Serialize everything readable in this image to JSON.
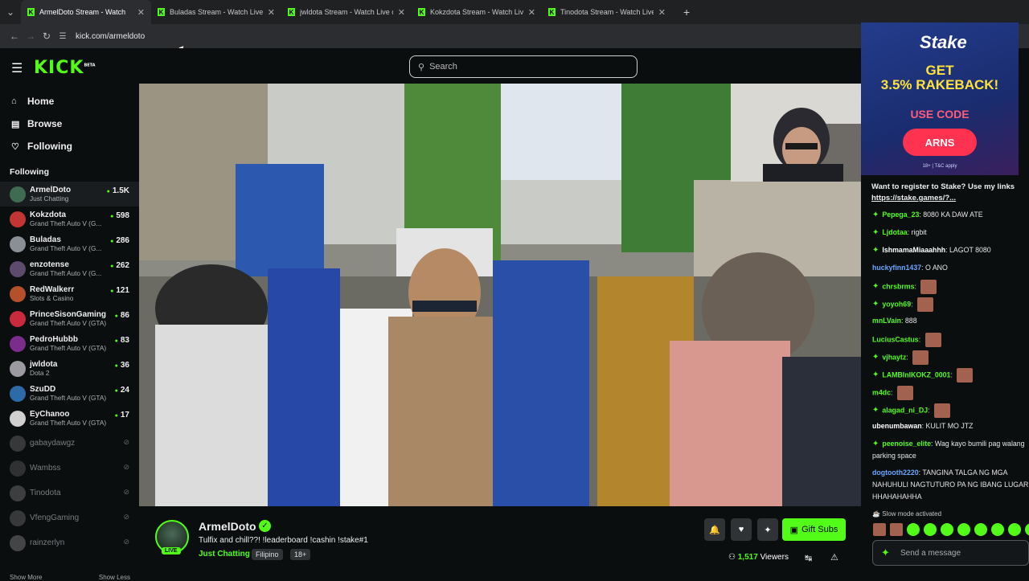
{
  "browser": {
    "tabs": [
      {
        "title": "ArmelDoto Stream - Watch",
        "active": true
      },
      {
        "title": "Buladas Stream - Watch Live on",
        "active": false
      },
      {
        "title": "jwldota Stream - Watch Live on",
        "active": false
      },
      {
        "title": "Kokzdota Stream - Watch Live o",
        "active": false
      },
      {
        "title": "Tinodota Stream - Watch Live o",
        "active": false
      }
    ],
    "url": "kick.com/armeldoto"
  },
  "header": {
    "logo": "KICK",
    "logo_beta": "BETA",
    "search_placeholder": "Search"
  },
  "sidebar": {
    "nav": [
      {
        "label": "Home",
        "icon": "home-icon"
      },
      {
        "label": "Browse",
        "icon": "browse-icon"
      },
      {
        "label": "Following",
        "icon": "heart-icon"
      }
    ],
    "following_title": "Following",
    "channels": [
      {
        "name": "ArmelDoto",
        "category": "Just Chatting",
        "viewers": "1.5K",
        "live": true,
        "color": "#3f6b52"
      },
      {
        "name": "Kokzdota",
        "category": "Grand Theft Auto V (G...",
        "viewers": "598",
        "live": true,
        "color": "#c23535"
      },
      {
        "name": "Buladas",
        "category": "Grand Theft Auto V (G...",
        "viewers": "286",
        "live": true,
        "color": "#8a8f96"
      },
      {
        "name": "enzotense",
        "category": "Grand Theft Auto V (G...",
        "viewers": "262",
        "live": true,
        "color": "#5d4b6e"
      },
      {
        "name": "RedWalkerr",
        "category": "Slots & Casino",
        "viewers": "121",
        "live": true,
        "color": "#b5502a"
      },
      {
        "name": "PrinceSisonGaming",
        "category": "Grand Theft Auto V (GTA)",
        "viewers": "86",
        "live": true,
        "color": "#c92a3e"
      },
      {
        "name": "PedroHubbb",
        "category": "Grand Theft Auto V (GTA)",
        "viewers": "83",
        "live": true,
        "color": "#7a2d8c"
      },
      {
        "name": "jwldota",
        "category": "Dota 2",
        "viewers": "36",
        "live": true,
        "color": "#9a9aa0"
      },
      {
        "name": "SzuDD",
        "category": "Grand Theft Auto V (GTA)",
        "viewers": "24",
        "live": true,
        "color": "#2d6ba8"
      },
      {
        "name": "EyChanoo",
        "category": "Grand Theft Auto V (GTA)",
        "viewers": "17",
        "live": true,
        "color": "#d0d0d0"
      },
      {
        "name": "gabaydawgz",
        "live": false,
        "color": "#777"
      },
      {
        "name": "Wambss",
        "live": false,
        "color": "#666"
      },
      {
        "name": "Tinodota",
        "live": false,
        "color": "#888"
      },
      {
        "name": "VfengGaming",
        "live": false,
        "color": "#777"
      },
      {
        "name": "rainzerlyn",
        "live": false,
        "color": "#999"
      }
    ],
    "show_more": "Show More",
    "show_less": "Show Less"
  },
  "stream": {
    "streamer": "ArmelDoto",
    "live_label": "LIVE",
    "title": "Tulfix and chill??! !leaderboard !cashin !stake#1",
    "category": "Just Chatting",
    "tags": [
      "Filipino",
      "18+"
    ],
    "viewers": "1,517",
    "viewers_label": "Viewers",
    "gift_label": "Gift Subs"
  },
  "ad": {
    "brand": "Stake",
    "line1": "GET",
    "line2": "3.5% RAKEBACK!",
    "code_label": "USE CODE",
    "code": "ARNS",
    "tc": "18+ | T&C apply"
  },
  "chat": {
    "pinned_text": "Want to register to Stake? Use my links",
    "pinned_link": "https://stake.games/?...",
    "messages": [
      {
        "user": "Pepega_23",
        "text": "8080 KA DAW ATE",
        "color": "#53fc18",
        "badge": true,
        "emote": false
      },
      {
        "user": "Ljdotaa",
        "text": "rigbit",
        "color": "#53fc18",
        "badge": true,
        "emote": false
      },
      {
        "user": "IshmamaMiaaahhh",
        "text": "LAGOT 8080",
        "color": "#ffffff",
        "badge": true,
        "emote": false
      },
      {
        "user": "huckyfinn1437",
        "text": "O ANO",
        "color": "#6aa7ff",
        "badge": false,
        "emote": false
      },
      {
        "user": "chrsbrms",
        "text": "",
        "color": "#53fc18",
        "badge": true,
        "emote": true
      },
      {
        "user": "yoyoh69",
        "text": "",
        "color": "#53fc18",
        "badge": true,
        "emote": true
      },
      {
        "user": "mnLVain",
        "text": "888",
        "color": "#53fc18",
        "badge": false,
        "emote": false
      },
      {
        "user": "LuciusCastus",
        "text": "",
        "color": "#53fc18",
        "badge": false,
        "emote": true
      },
      {
        "user": "vjhaytz",
        "text": "",
        "color": "#53fc18",
        "badge": true,
        "emote": true
      },
      {
        "user": "LAMBInIKOKZ_0001",
        "text": "",
        "color": "#53fc18",
        "badge": true,
        "emote": true
      },
      {
        "user": "m4dc",
        "text": "",
        "color": "#53fc18",
        "badge": false,
        "emote": true
      },
      {
        "user": "alagad_ni_DJ",
        "text": "",
        "color": "#53fc18",
        "badge": true,
        "emote": true
      },
      {
        "user": "ubenumbawan",
        "text": "KULIT MO JTZ",
        "color": "#ffffff",
        "badge": false,
        "emote": false
      },
      {
        "user": "peenoise_elite",
        "text": "Wag kayo bumili pag walang parking space",
        "color": "#53fc18",
        "badge": true,
        "emote": false
      },
      {
        "user": "dogtooth2220",
        "text": "TANGINA TALGA NG MGA NAHUHULI NAGTUTURO PA NG IBANG LUGAR HHAHAHAHHA",
        "color": "#6aa7ff",
        "badge": false,
        "emote": false
      }
    ],
    "slow_mode": "Slow mode activated",
    "send_placeholder": "Send a message"
  }
}
